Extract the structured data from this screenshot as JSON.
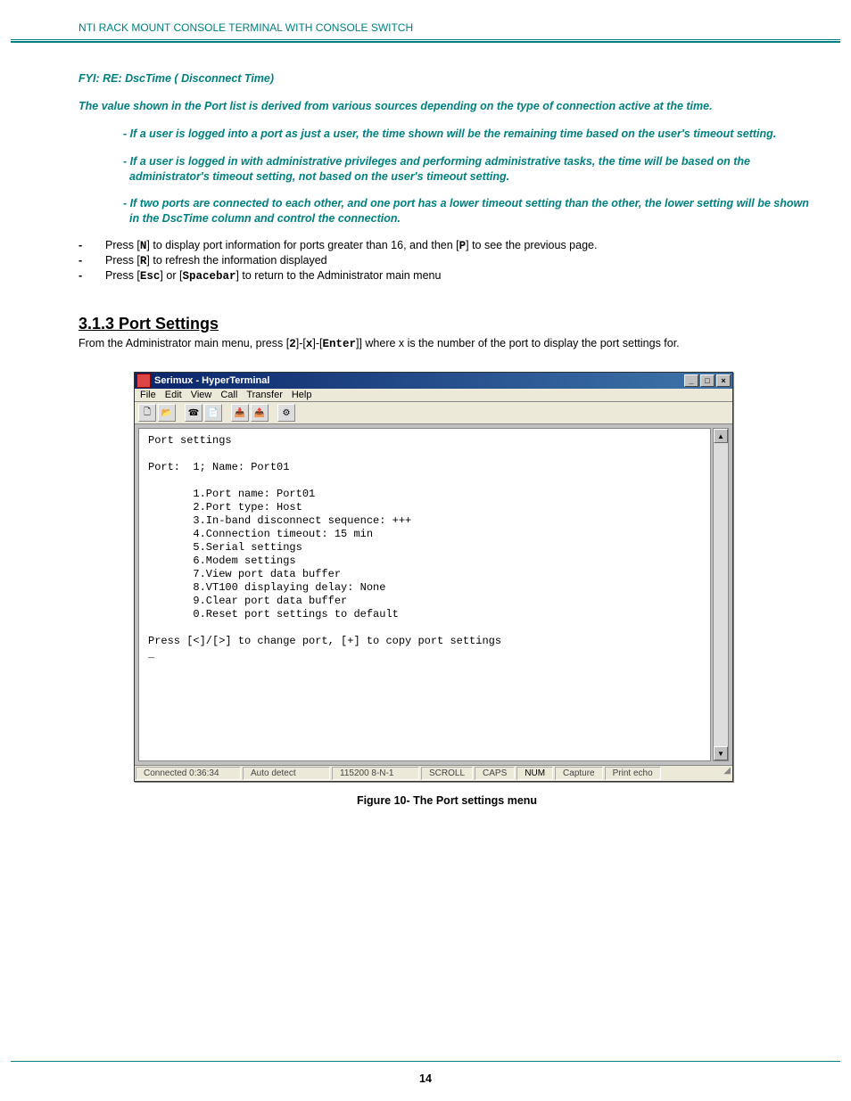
{
  "header": {
    "title": "NTI RACK MOUNT CONSOLE TERMINAL WITH CONSOLE SWITCH"
  },
  "page_number": "14",
  "fyi": {
    "title": "FYI: RE: DscTime ( Disconnect Time)",
    "lead": "The value shown in the Port list is derived from various sources depending on the type of connection active at the time.",
    "bullets": [
      "If a user is logged into a port as just a user,  the time shown will be the remaining time based on the user's timeout setting.",
      "If a user is logged in with administrative privileges and performing administrative tasks,  the time will be based on the  administrator's timeout setting,  not based on the user's timeout setting.",
      "If two ports are connected to each other,  and one port has a lower timeout setting than the other,   the lower setting will be shown in the DscTime column and control the connection."
    ]
  },
  "actions": [
    {
      "pre": "Press [",
      "k1": "N",
      "mid": "] to display port information for ports greater than 16, and then [",
      "k2": "P",
      "post": "] to see the previous page."
    },
    {
      "pre": "Press [",
      "k1": "R",
      "mid": "] to refresh the information displayed",
      "k2": "",
      "post": ""
    },
    {
      "pre": "Press [",
      "k1": "Esc",
      "mid": "] or [",
      "k2": "Spacebar",
      "post": "] to return to the Administrator main menu"
    }
  ],
  "section": {
    "number_title": "3.1.3 Port Settings",
    "intro_pre": "From the Administrator main menu, press [",
    "k1": "2",
    "sep1": "]-[",
    "k2": "x",
    "sep2": "]-[",
    "k3": "Enter",
    "intro_post": "]] where x is the number of the port to display the port settings for."
  },
  "ht": {
    "title": "Serimux - HyperTerminal",
    "menus": [
      "File",
      "Edit",
      "View",
      "Call",
      "Transfer",
      "Help"
    ],
    "win_btn_min": "_",
    "win_btn_max": "□",
    "win_btn_close": "×",
    "tool_icons": [
      "🗋",
      "📂",
      "",
      "☎",
      "📄",
      "",
      "📥",
      "📤",
      "",
      "⚙"
    ],
    "scroll_up": "▲",
    "scroll_down": "▼",
    "term": "Port settings\n\nPort:  1; Name: Port01\n\n       1.Port name: Port01\n       2.Port type: Host\n       3.In-band disconnect sequence: +++\n       4.Connection timeout: 15 min\n       5.Serial settings\n       6.Modem settings\n       7.View port data buffer\n       8.VT100 displaying delay: None\n       9.Clear port data buffer\n       0.Reset port settings to default\n\nPress [<]/[>] to change port, [+] to copy port settings\n_",
    "status": {
      "time": "Connected 0:36:34",
      "detect": "Auto detect",
      "conn": "115200 8-N-1",
      "scroll": "SCROLL",
      "caps": "CAPS",
      "num": "NUM",
      "capture": "Capture",
      "echo": "Print echo"
    }
  },
  "figure_caption": "Figure 10- The Port settings menu"
}
